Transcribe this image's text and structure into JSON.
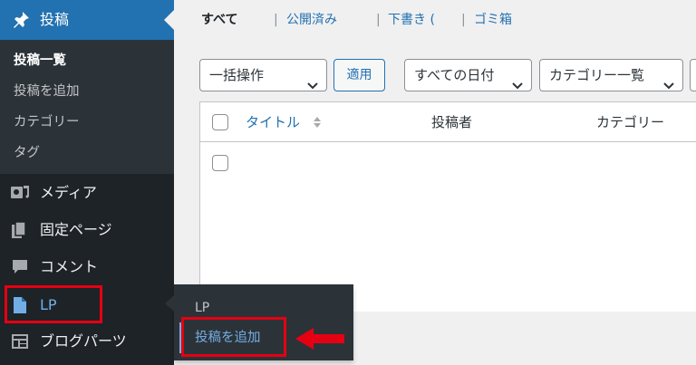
{
  "sidebar": {
    "posts_label": "投稿",
    "submenu": [
      "投稿一覧",
      "投稿を追加",
      "カテゴリー",
      "タグ"
    ],
    "items": [
      {
        "label": "メディア",
        "icon": "media-icon"
      },
      {
        "label": "固定ページ",
        "icon": "page-icon"
      },
      {
        "label": "コメント",
        "icon": "comment-icon"
      },
      {
        "label": "LP",
        "icon": "document-icon"
      },
      {
        "label": "ブログパーツ",
        "icon": "layout-icon"
      }
    ]
  },
  "flyout": {
    "heading": "LP",
    "add_new": "投稿を追加"
  },
  "views": {
    "all": "すべて",
    "published": "公開済み",
    "draft": "下書き (",
    "trash": "ゴミ箱"
  },
  "filters": {
    "bulk_action": "一括操作",
    "apply": "適用",
    "all_dates": "すべての日付",
    "category": "カテゴリー一覧"
  },
  "table": {
    "columns": [
      "タイトル",
      "投稿者",
      "カテゴリー"
    ]
  },
  "colors": {
    "admin_bar": "#1d2327",
    "accent": "#2271b1",
    "highlight": "#e50012"
  }
}
